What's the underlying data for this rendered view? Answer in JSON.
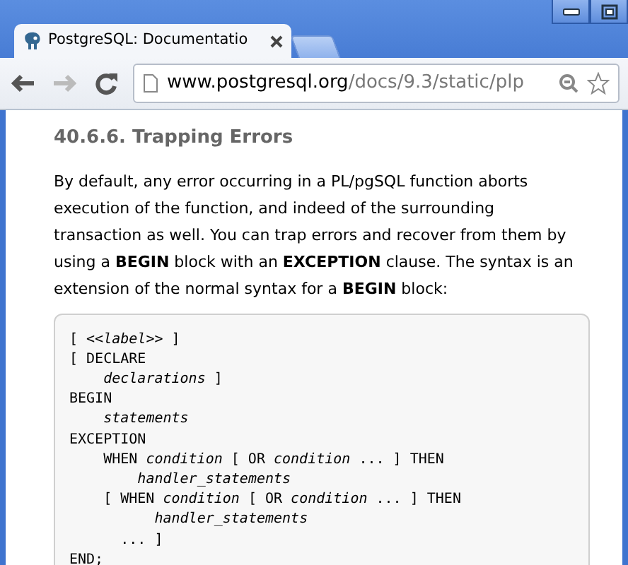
{
  "tabs": [
    {
      "title": "PostgreSQL: Documentatio",
      "selected": true
    }
  ],
  "toolbar": {
    "url_host": "www.postgresql.org",
    "url_path": "/docs/9.3/static/plp"
  },
  "page": {
    "heading": "40.6.6. Trapping Errors",
    "paragraph": "By default, any error occurring in a PL/pgSQL function aborts execution of the function, and indeed of the surrounding transaction as well. You can trap errors and recover from them by using a **BEGIN** block with an **EXCEPTION** clause. The syntax is an extension of the normal syntax for a **BEGIN** block:",
    "code_lines": [
      "[ <<*label*>> ]",
      "[ DECLARE",
      "    *declarations* ]",
      "BEGIN",
      "    *statements*",
      "EXCEPTION",
      "    WHEN *condition* [ OR *condition* ... ] THEN",
      "        *handler_statements*",
      "    [ WHEN *condition* [ OR *condition* ... ] THEN",
      "          *handler_statements*",
      "      ... ]",
      "END;"
    ]
  }
}
